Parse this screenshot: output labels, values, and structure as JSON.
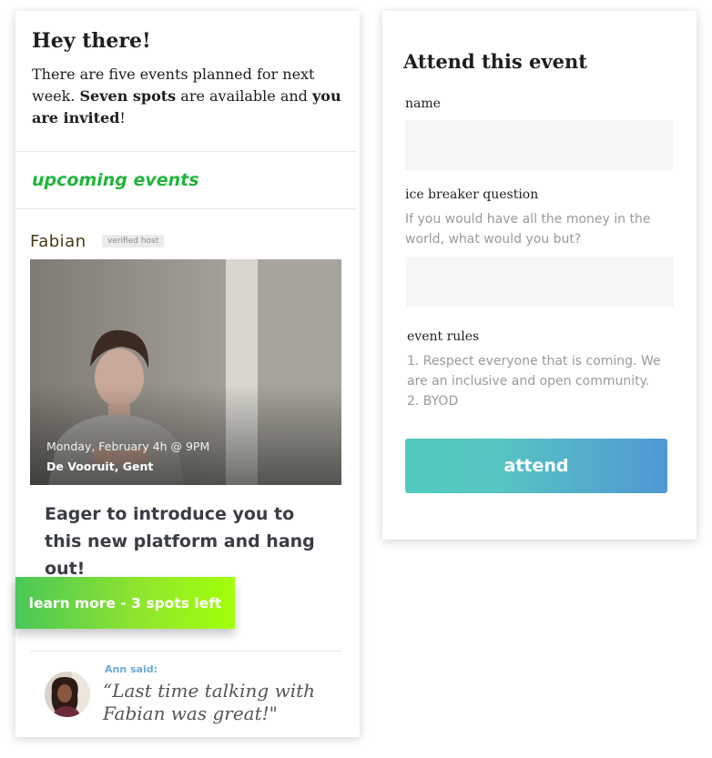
{
  "greeting": {
    "title": "Hey there!",
    "intro_part1": "There are five events planned for next week. ",
    "intro_bold1": "Seven spots",
    "intro_part2": " are available and ",
    "intro_bold2": "you are invited",
    "intro_part3": "!"
  },
  "events": {
    "section_title": "upcoming events",
    "event": {
      "host_name": "Fabian",
      "host_badge": "verified host",
      "date_time": "Monday, February 4h @ 9PM",
      "location": "De Vooruit, Gent",
      "description": "Eager to introduce you to this new platform and hang out!",
      "cta_label": "learn more - 3 spots left"
    }
  },
  "review": {
    "author_label": "Ann said:",
    "quote": "“Last time talking with Fabian was great!\""
  },
  "form": {
    "title": "Attend this event",
    "name_label": "name",
    "name_value": "",
    "question_label": "ice breaker question",
    "question_prompt": "If you would have all the money in the world, what would you but?",
    "answer_value": "",
    "rules_label": "event rules",
    "rule_1": "1. Respect everyone that is coming. We are an inclusive and open community.",
    "rule_2": "2. BYOD",
    "submit_label": "attend"
  },
  "colors": {
    "accent_green": "#22b53c",
    "cta_gradient_start": "#49c758",
    "cta_gradient_end": "#a2ff08",
    "attend_gradient_start": "#50cbbc",
    "attend_gradient_end": "#5097d4",
    "review_author": "#6aa9d8"
  },
  "icons": {
    "host_photo": "portrait-photo",
    "reviewer_avatar": "avatar-photo"
  }
}
